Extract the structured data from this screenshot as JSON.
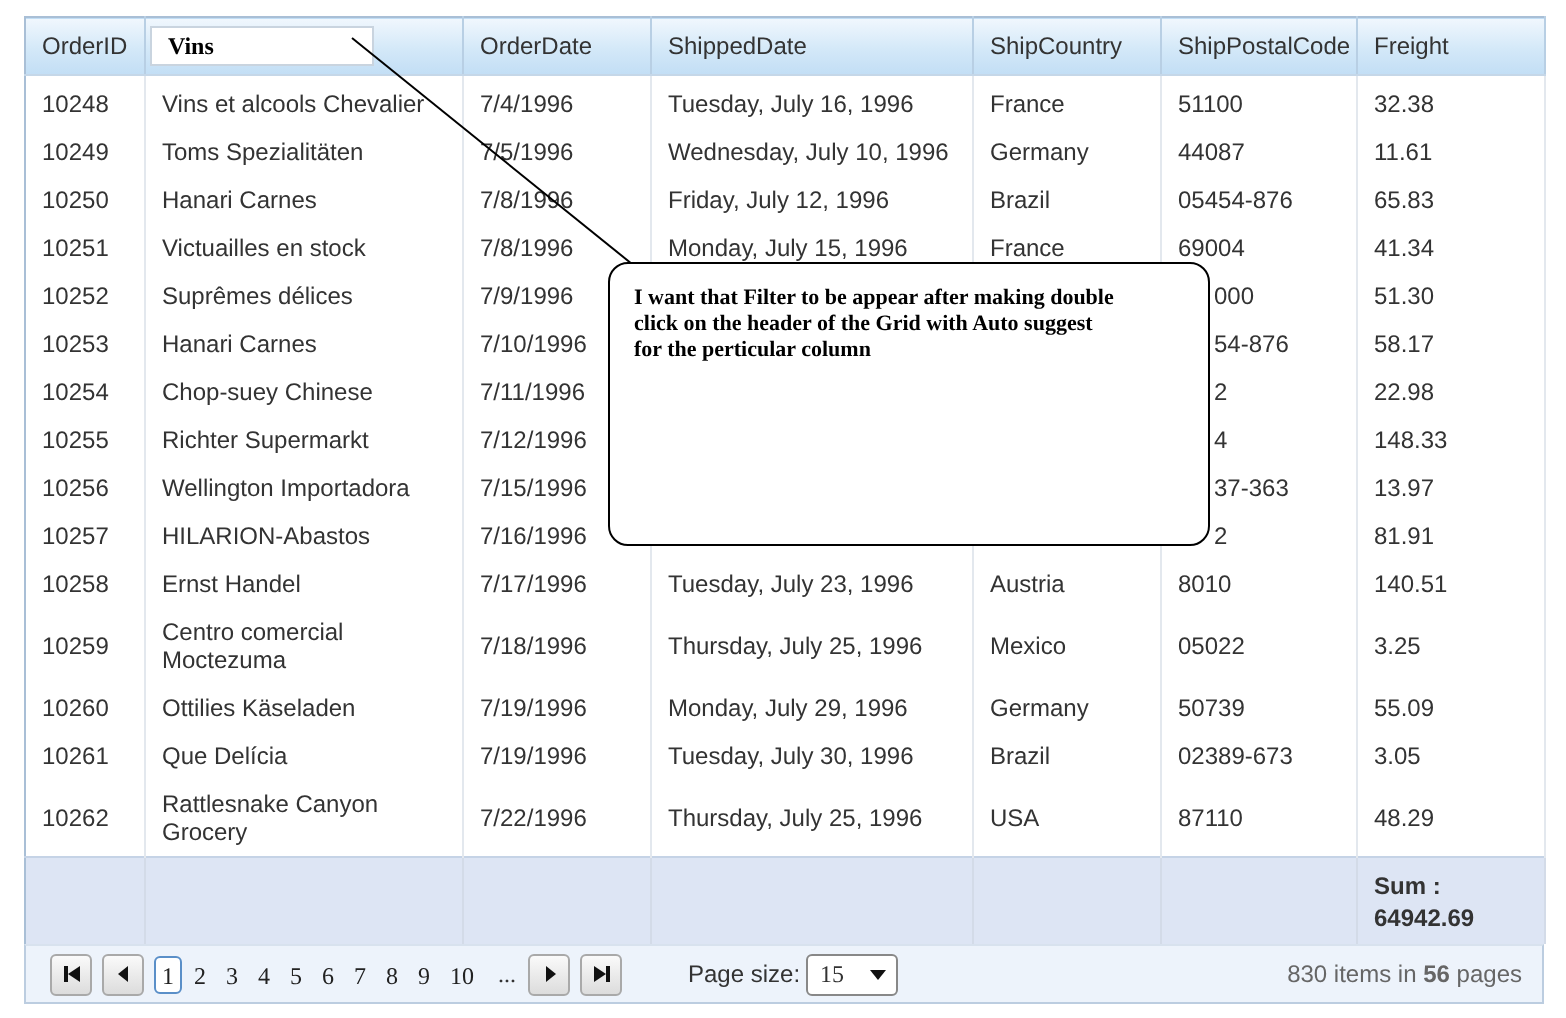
{
  "grid": {
    "columns": [
      {
        "kind": "text",
        "label": "OrderID"
      },
      {
        "kind": "filter",
        "value": "Vins"
      },
      {
        "kind": "text",
        "label": "OrderDate"
      },
      {
        "kind": "text",
        "label": "ShippedDate"
      },
      {
        "kind": "text",
        "label": "ShipCountry"
      },
      {
        "kind": "text",
        "label": "ShipPostalCode"
      },
      {
        "kind": "text",
        "label": "Freight"
      }
    ],
    "rows": [
      {
        "order_id": "10248",
        "customer": "Vins et alcools Chevalier",
        "order_date": "7/4/1996",
        "shipped_date": "Tuesday, July 16, 1996",
        "country": "France",
        "postal": "51100",
        "freight": "32.38"
      },
      {
        "order_id": "10249",
        "customer": "Toms Spezialitäten",
        "order_date": "7/5/1996",
        "shipped_date": "Wednesday, July 10, 1996",
        "country": "Germany",
        "postal": "44087",
        "freight": "11.61"
      },
      {
        "order_id": "10250",
        "customer": "Hanari Carnes",
        "order_date": "7/8/1996",
        "shipped_date": "Friday, July 12, 1996",
        "country": "Brazil",
        "postal": "05454-876",
        "freight": "65.83"
      },
      {
        "order_id": "10251",
        "customer": "Victuailles en stock",
        "order_date": "7/8/1996",
        "shipped_date": "Monday, July 15, 1996",
        "country": "France",
        "postal": "69004",
        "freight": "41.34"
      },
      {
        "order_id": "10252",
        "customer": "Suprêmes délices",
        "order_date": "7/9/1996",
        "postal": "000",
        "freight": "51.30"
      },
      {
        "order_id": "10253",
        "customer": "Hanari Carnes",
        "order_date": "7/10/1996",
        "postal": "54-876",
        "freight": "58.17"
      },
      {
        "order_id": "10254",
        "customer": "Chop-suey Chinese",
        "order_date": "7/11/1996",
        "postal": "2",
        "freight": "22.98"
      },
      {
        "order_id": "10255",
        "customer": "Richter Supermarkt",
        "order_date": "7/12/1996",
        "postal": "4",
        "freight": "148.33"
      },
      {
        "order_id": "10256",
        "customer": "Wellington Importadora",
        "order_date": "7/15/1996",
        "postal": "37-363",
        "freight": "13.97"
      },
      {
        "order_id": "10257",
        "customer": "HILARION-Abastos",
        "order_date": "7/16/1996",
        "postal": "2",
        "freight": "81.91"
      },
      {
        "order_id": "10258",
        "customer": "Ernst Handel",
        "order_date": "7/17/1996",
        "shipped_date": "Tuesday, July 23, 1996",
        "country": "Austria",
        "postal": "8010",
        "freight": "140.51"
      },
      {
        "order_id": "10259",
        "customer": "Centro comercial Moctezuma",
        "order_date": "7/18/1996",
        "shipped_date": "Thursday, July 25, 1996",
        "country": "Mexico",
        "postal": "05022",
        "freight": "3.25"
      },
      {
        "order_id": "10260",
        "customer": "Ottilies Käseladen",
        "order_date": "7/19/1996",
        "shipped_date": "Monday, July 29, 1996",
        "country": "Germany",
        "postal": "50739",
        "freight": "55.09"
      },
      {
        "order_id": "10261",
        "customer": "Que Delícia",
        "order_date": "7/19/1996",
        "shipped_date": "Tuesday, July 30, 1996",
        "country": "Brazil",
        "postal": "02389-673",
        "freight": "3.05"
      },
      {
        "order_id": "10262",
        "customer": "Rattlesnake Canyon Grocery",
        "order_date": "7/22/1996",
        "shipped_date": "Thursday, July 25, 1996",
        "country": "USA",
        "postal": "87110",
        "freight": "48.29"
      }
    ],
    "footer": {
      "label": "Sum :",
      "value": "64942.69"
    }
  },
  "callout": {
    "text": "I want that Filter to be appear after making double\nclick on the header of the Grid with Auto suggest\nfor the perticular column"
  },
  "pager": {
    "pages": [
      {
        "label": "1",
        "selected": true
      },
      {
        "label": "2",
        "selected": false
      },
      {
        "label": "3",
        "selected": false
      },
      {
        "label": "4",
        "selected": false
      },
      {
        "label": "5",
        "selected": false
      },
      {
        "label": "6",
        "selected": false
      },
      {
        "label": "7",
        "selected": false
      },
      {
        "label": "8",
        "selected": false
      },
      {
        "label": "9",
        "selected": false
      },
      {
        "label": "10",
        "selected": false
      }
    ],
    "more": "...",
    "page_size_label": "Page size:",
    "page_size": "15",
    "summary": "830 items in **56** pages"
  }
}
